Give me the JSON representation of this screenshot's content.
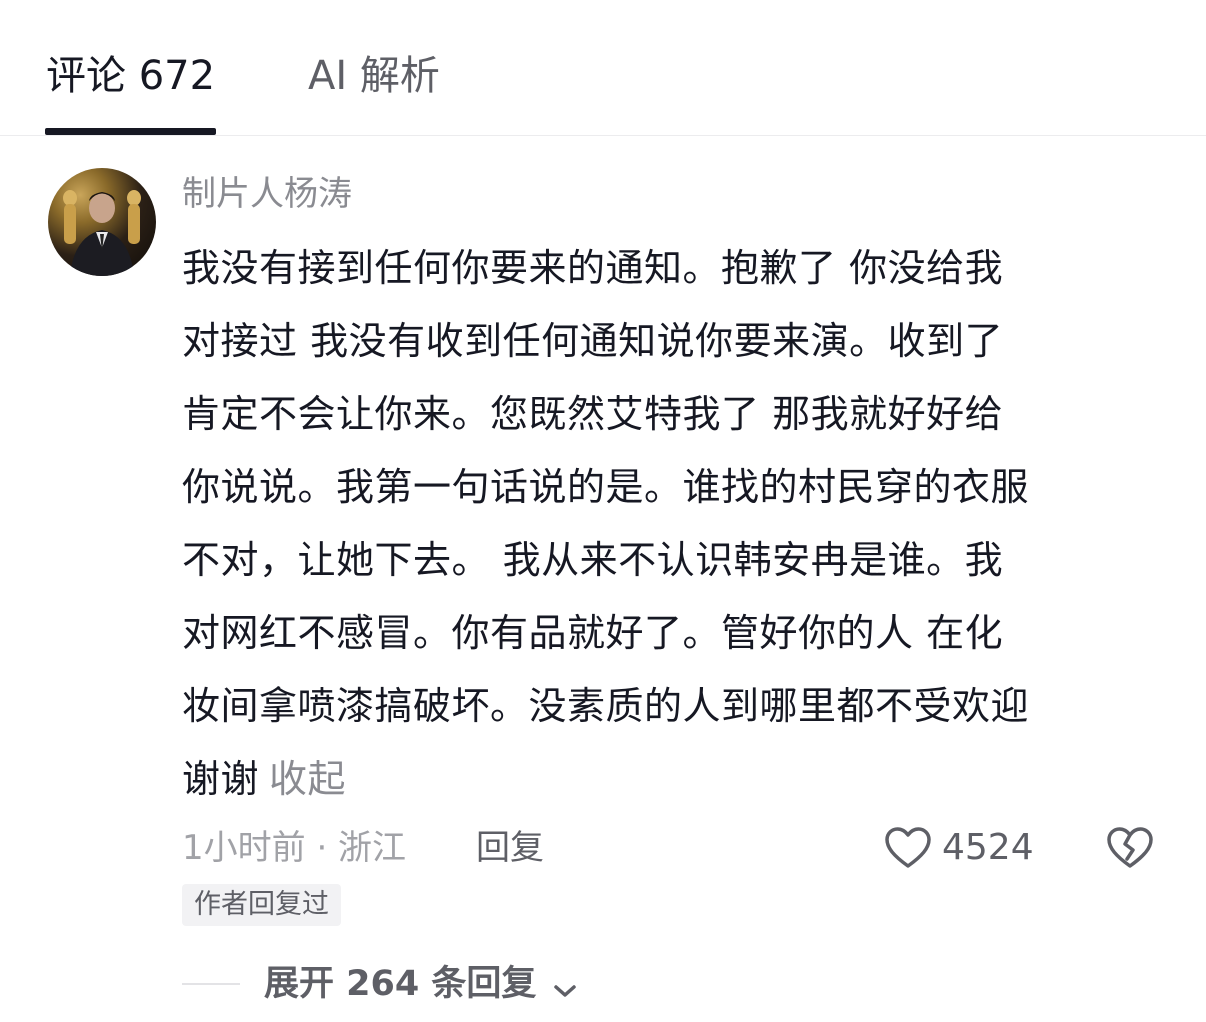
{
  "tabs": [
    {
      "label": "评论 672",
      "active": true
    },
    {
      "label": "AI 解析",
      "active": false
    }
  ],
  "comment": {
    "username": "制片人杨涛",
    "text_lines": [
      "我没有接到任何你要来的通知。抱歉了 你没给我",
      "对接过 我没有收到任何通知说你要来演。收到了",
      "肯定不会让你来。您既然艾特我了 那我就好好给",
      "你说说。我第一句话说的是。谁找的村民穿的衣服",
      "不对，让她下去。 我从来不认识韩安冉是谁。我",
      "对网红不感冒。你有品就好了。管好你的人 在化",
      "妆间拿喷漆搞破坏。没素质的人到哪里都不受欢迎",
      "谢谢"
    ],
    "collapse_label": "收起",
    "time_location": "1小时前 · 浙江",
    "reply_label": "回复",
    "like_count": "4524",
    "author_replied_badge": "作者回复过",
    "expand_replies_label": "展开 264 条回复"
  },
  "icons": {
    "like": "heart-outline-icon",
    "dislike": "broken-heart-icon",
    "expand": "chevron-down-icon"
  },
  "colors": {
    "primary_text": "#161823",
    "secondary_text": "#8a8b91",
    "muted_text": "#a1a2a7",
    "icon_gray": "#5e5f66"
  }
}
